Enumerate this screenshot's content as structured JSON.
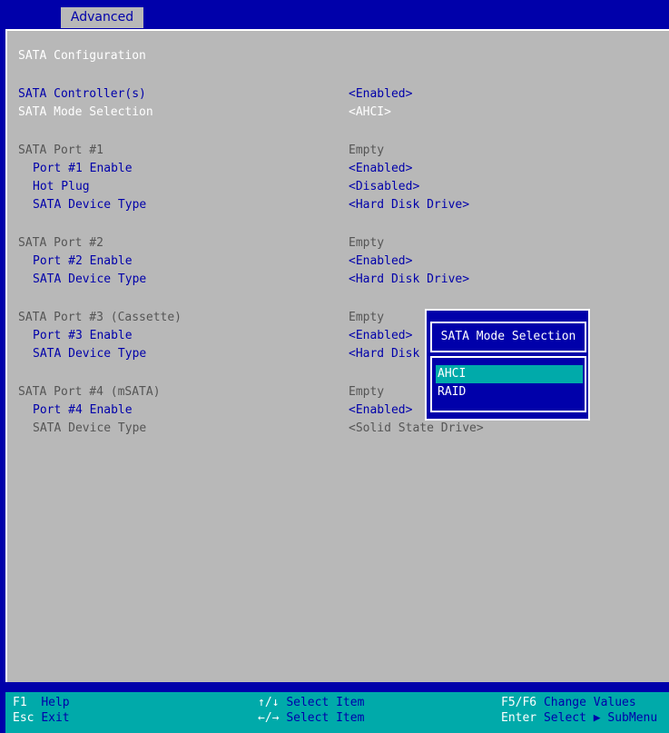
{
  "tabs": [
    {
      "label": "Advanced"
    }
  ],
  "page_title": "SATA Configuration",
  "rows": [
    {
      "label": "SATA Controller(s)",
      "value": "<Enabled>"
    },
    {
      "label": "SATA Mode Selection",
      "value": "<AHCI>"
    },
    {
      "label": "SATA Port #1",
      "value": "Empty"
    },
    {
      "label": "Port #1 Enable",
      "value": "<Enabled>"
    },
    {
      "label": "Hot Plug",
      "value": "<Disabled>"
    },
    {
      "label": "SATA Device Type",
      "value": "<Hard Disk Drive>"
    },
    {
      "label": "SATA Port #2",
      "value": "Empty"
    },
    {
      "label": "Port #2 Enable",
      "value": "<Enabled>"
    },
    {
      "label": "SATA Device Type",
      "value": "<Hard Disk Drive>"
    },
    {
      "label": "SATA Port #3 (Cassette)",
      "value": "Empty"
    },
    {
      "label": "Port #3 Enable",
      "value": "<Enabled>"
    },
    {
      "label": "SATA Device Type",
      "value": "<Hard Disk"
    },
    {
      "label": "SATA Port #4 (mSATA)",
      "value": "Empty"
    },
    {
      "label": "Port #4 Enable",
      "value": "<Enabled>"
    },
    {
      "label": "SATA Device Type",
      "value": "<Solid State Drive>"
    }
  ],
  "popup": {
    "title": "SATA Mode Selection",
    "options": [
      {
        "label": "AHCI",
        "selected": true
      },
      {
        "label": "RAID",
        "selected": false
      }
    ]
  },
  "footer": {
    "items": [
      {
        "key": "F1",
        "desc": "Help"
      },
      {
        "key": "Esc",
        "desc": "Exit"
      },
      {
        "key": "↑/↓",
        "desc": "Select Item"
      },
      {
        "key": "←/→",
        "desc": "Select Item"
      },
      {
        "key": "F5/F6",
        "desc": "Change Values"
      },
      {
        "key": "Enter",
        "desc": "Select ▶ SubMenu"
      }
    ]
  },
  "colors": {
    "background": "#0000aa",
    "panel": "#b8b8b8",
    "highlight": "#00aaaa",
    "text_active": "#0000aa",
    "text_dim": "#555555"
  }
}
